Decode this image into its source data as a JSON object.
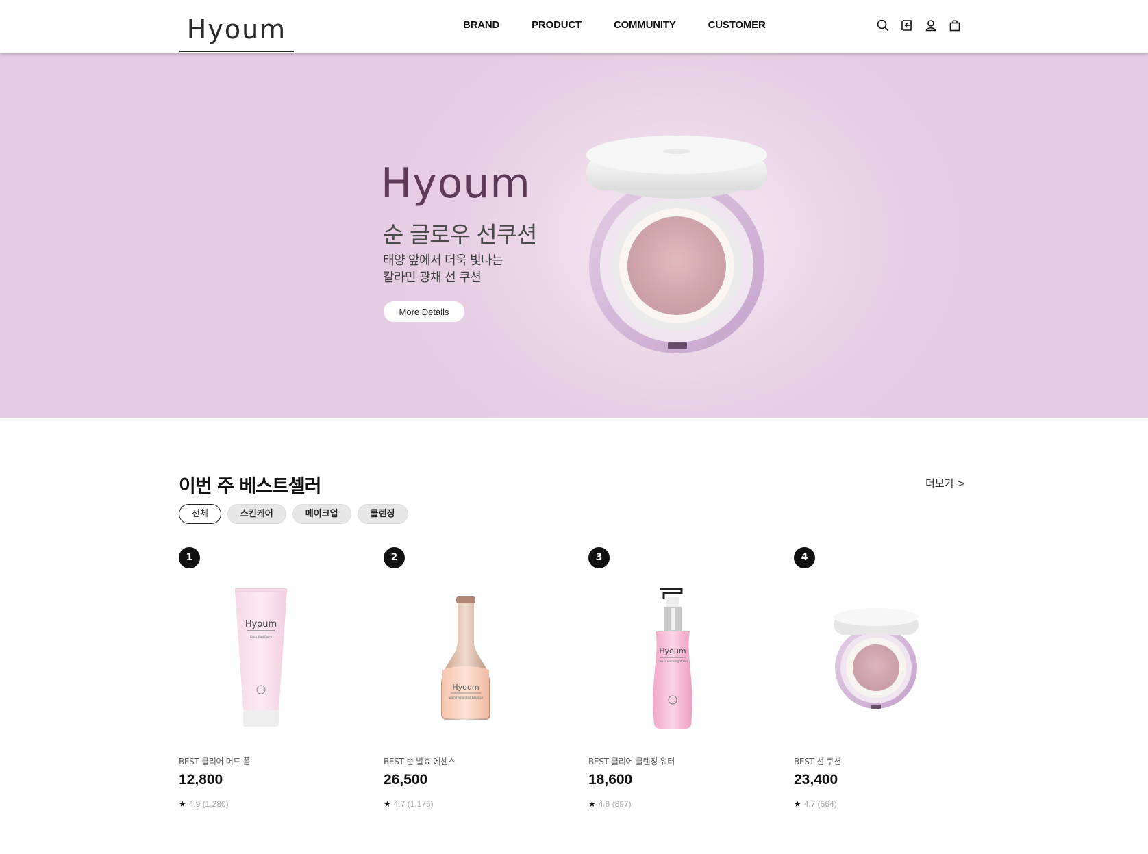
{
  "header": {
    "logo": "Hyoum",
    "nav": [
      "BRAND",
      "PRODUCT",
      "COMMUNITY",
      "CUSTOMER"
    ],
    "icons": [
      "search-icon",
      "login-icon",
      "user-icon",
      "cart-icon"
    ]
  },
  "hero": {
    "brand": "Hyoum",
    "title": "순 글로우 선쿠션",
    "subtitle_line1": "태양 앞에서 더욱 빛나는",
    "subtitle_line2": "칼라민 광채 선 쿠션",
    "button": "More Details"
  },
  "bestsellers": {
    "title": "이번 주 베스트셀러",
    "more": "더보기 >",
    "filters": [
      "전체",
      "스킨케어",
      "메이크업",
      "클렌징"
    ],
    "active_filter": "전체",
    "products": [
      {
        "rank": "1",
        "name": "BEST 클리어 머드 폼",
        "price": "12,800",
        "star": "★",
        "rating": "4.9 (1,280)",
        "label": "Hyoum",
        "sublabel": "Clear Mud Foam"
      },
      {
        "rank": "2",
        "name": "BEST 순 발효 에센스",
        "price": "26,500",
        "star": "★",
        "rating": "4.7 (1,175)",
        "label": "Hyoum",
        "sublabel": "Soon Fermented Essence"
      },
      {
        "rank": "3",
        "name": "BEST 클리어 클렌징 워터",
        "price": "18,600",
        "star": "★",
        "rating": "4.8 (897)",
        "label": "Hyoum",
        "sublabel": "Clear Cleansing Water"
      },
      {
        "rank": "4",
        "name": "BEST 선 쿠션",
        "price": "23,400",
        "star": "★",
        "rating": "4.7 (564)",
        "label": "",
        "sublabel": ""
      }
    ]
  },
  "colors": {
    "hero_bg": "#e6cce3",
    "brand_purple": "#5c3a58",
    "chip_bg": "#e7e7e7",
    "rank_bg": "#111111"
  }
}
